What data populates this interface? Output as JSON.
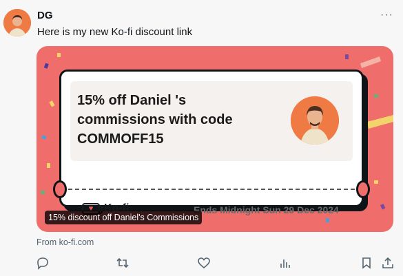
{
  "post": {
    "author": "DG",
    "more_label": "···",
    "text": "Here is my new Ko-fi discount link"
  },
  "card": {
    "title": "15% off Daniel 's commissions with code COMMOFF15",
    "brand": "Ko-fi",
    "ends": "Ends Midnight Sun 29 Dec 2024",
    "caption": "15% discount off Daniel's Commissions",
    "source": "From ko-fi.com",
    "background_color": "#ef6d6a"
  },
  "actions": {
    "icons": [
      "reply-icon",
      "retweet-icon",
      "like-icon",
      "views-icon",
      "bookmark-icon",
      "share-icon"
    ]
  }
}
